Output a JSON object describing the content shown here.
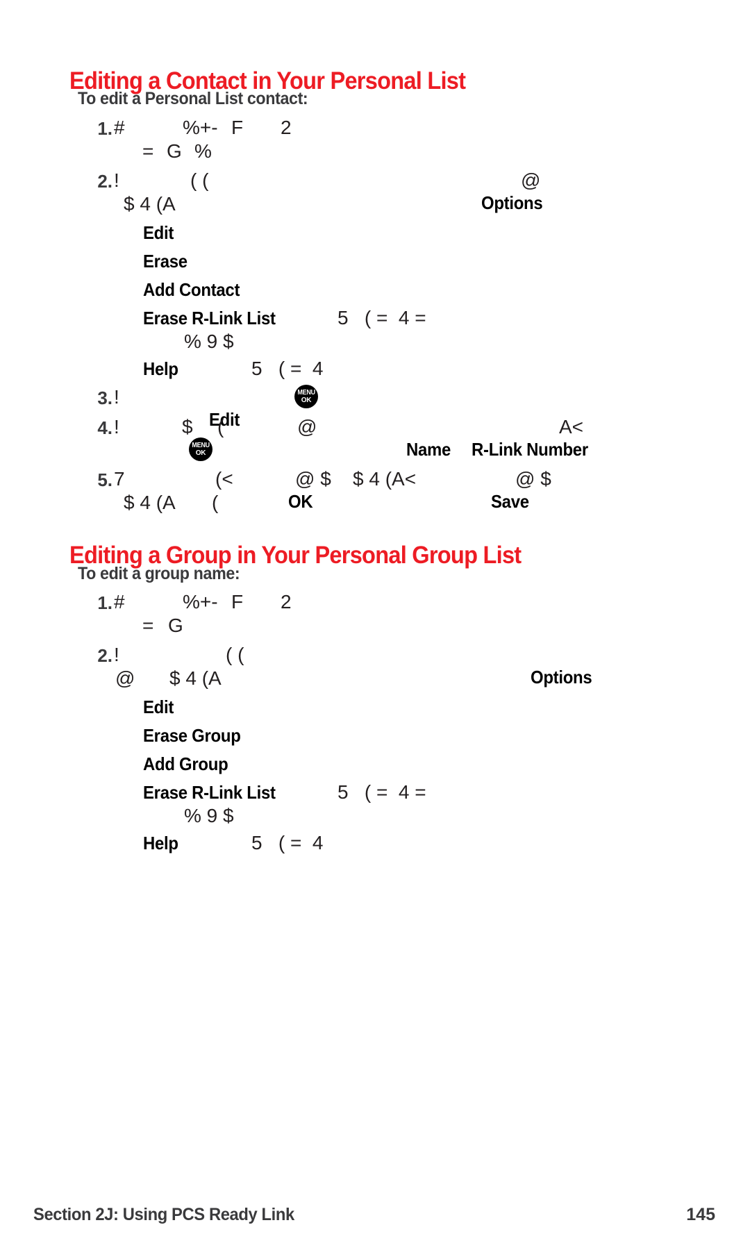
{
  "page": {
    "accent_color": "#ed1c24",
    "text_color": "#231f20",
    "muted_color": "#3a3a3c"
  },
  "sections": [
    {
      "heading": "Editing a Contact in Your Personal List",
      "subheading": "To edit a Personal List contact:",
      "steps": [
        {
          "num": "1.",
          "line1_a": "#",
          "line1_b": "%+-",
          "line1_c": "F",
          "line1_d": "2",
          "line2_a": "=",
          "line2_b": "G",
          "line2_c": "%"
        },
        {
          "num": "2.",
          "line1_a": "!",
          "line1_b": "( (",
          "line1_label": "Options",
          "line1_c": "@",
          "line2": "$ 4 (A"
        },
        {
          "num": "3.",
          "line1_a": "!",
          "line1_label": "Edit",
          "icon": "menu-ok-key"
        },
        {
          "num": "4.",
          "line1_a": "!",
          "line1_b": "$",
          "line1_c": "(",
          "line1_d": "@",
          "label_1": "Name",
          "label_2": "R-Link Number",
          "line1_e": "A<",
          "icon": "menu-ok-key"
        },
        {
          "num": "5.",
          "line1_a": "7",
          "line1_b": "(<",
          "label_1": "OK",
          "line1_c": "@ $",
          "line1_d": "$ 4 (A<",
          "label_2": "Save",
          "line1_e": "@ $",
          "line2_a": "$ 4 (A",
          "line2_b": "("
        }
      ],
      "menu_items": [
        {
          "label": "Edit",
          "trail": ""
        },
        {
          "label": "Erase",
          "trail": ""
        },
        {
          "label": "Add Contact",
          "trail": ""
        },
        {
          "label": "Erase R-Link List",
          "trail": "5   ( =  4 =",
          "trail2": "% 9 $"
        },
        {
          "label": "Help",
          "trail": "5   ( =  4"
        }
      ]
    },
    {
      "heading": "Editing a Group in Your Personal Group List",
      "subheading": "To edit a group name:",
      "steps": [
        {
          "num": "1.",
          "line1_a": "#",
          "line1_b": "%+-",
          "line1_c": "F",
          "line1_d": "2",
          "line2_a": "=",
          "line2_b": "G"
        },
        {
          "num": "2.",
          "line1_a": "!",
          "line1_b": "( (",
          "line1_label": "Options",
          "line2_a": "@",
          "line2_b": "$ 4 (A"
        }
      ],
      "menu_items": [
        {
          "label": "Edit",
          "trail": ""
        },
        {
          "label": "Erase Group",
          "trail": ""
        },
        {
          "label": "Add Group",
          "trail": ""
        },
        {
          "label": "Erase R-Link List",
          "trail": "5   ( =  4 =",
          "trail2": "% 9 $"
        },
        {
          "label": "Help",
          "trail": "5   ( =  4"
        }
      ]
    }
  ],
  "icons": {
    "menu_ok": {
      "line1": "MENU",
      "line2": "OK"
    }
  },
  "footer": {
    "left": "Section 2J: Using PCS Ready Link",
    "right": "145"
  }
}
